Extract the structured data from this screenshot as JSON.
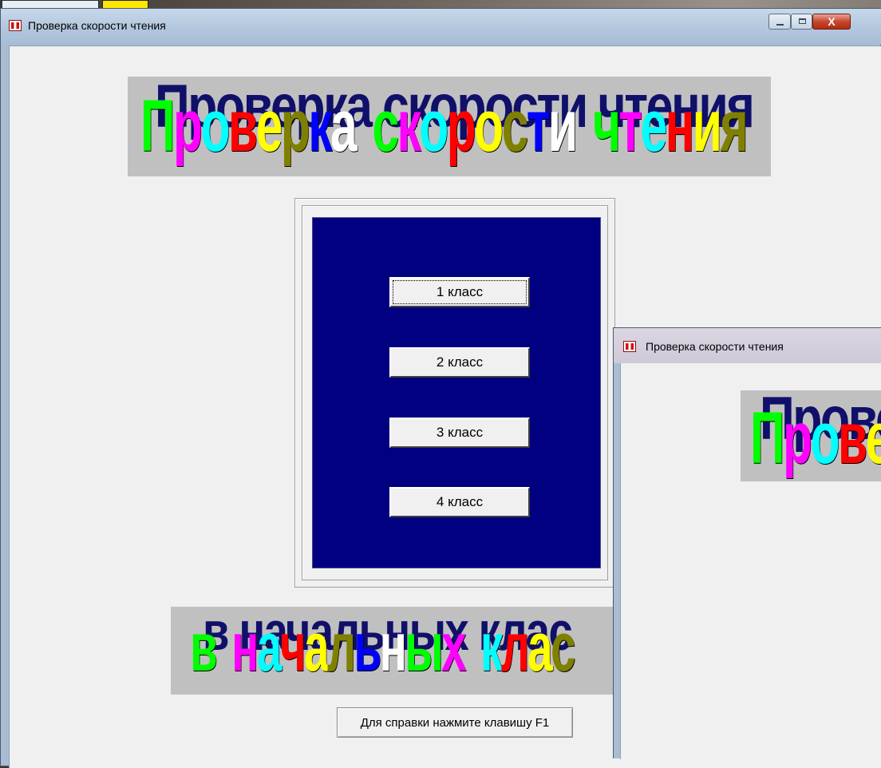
{
  "main_window": {
    "title": "Проверка скорости чтения",
    "controls": {
      "minimize": "minimize-icon",
      "maximize": "maximize-icon",
      "close_glyph": "X"
    }
  },
  "banner_top": {
    "text": "Проверка скорости чтения",
    "letters": [
      "П",
      "р",
      "о",
      "в",
      "е",
      "р",
      "к",
      "а",
      " ",
      "с",
      "к",
      "о",
      "р",
      "о",
      "с",
      "т",
      "и",
      " ",
      "ч",
      "т",
      "е",
      "н",
      "и",
      "я"
    ]
  },
  "banner_bottom": {
    "text": "в начальных клас",
    "letters": [
      "в",
      " ",
      "н",
      "а",
      "ч",
      "а",
      "л",
      "ь",
      "н",
      "ы",
      "х",
      " ",
      "к",
      "л",
      "а",
      "с"
    ]
  },
  "grades": [
    "1 класс",
    "2 класс",
    "3 класс",
    "4 класс"
  ],
  "help_button": "Для справки нажмите клавишу F1",
  "second_window": {
    "title": "Проверка скорости чтения",
    "banner_text": "Прове",
    "banner_letters": [
      "П",
      "р",
      "о",
      "в",
      "е"
    ]
  },
  "colors": {
    "panel_background": "#000080",
    "banner_background": "#c0c0c0",
    "wordart_shadow": "#10106a",
    "letter_cycle": [
      "#00ff00",
      "#ff00ff",
      "#00ffff",
      "#ff0000",
      "#ffff00",
      "#808000",
      "#0000ff",
      "#ffffff"
    ]
  }
}
